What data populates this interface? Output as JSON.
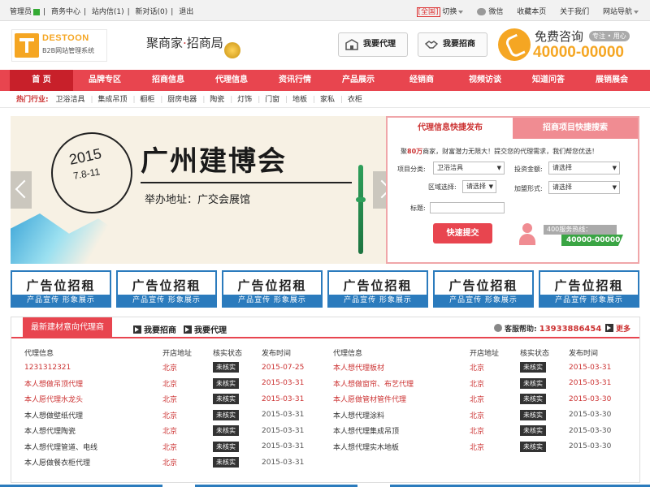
{
  "topbar": {
    "left": [
      "管理员",
      "商务中心",
      "站内信(1)",
      "新对话(0)",
      "退出"
    ],
    "region": "[全国]",
    "switch": "切换",
    "wechat": "微信",
    "fav": "收藏本页",
    "about": "关于我们",
    "sitenav": "网站导航"
  },
  "header": {
    "logo_name": "DESTOON",
    "logo_sub": "B2B网站管理系统",
    "slogan_a": "聚商家",
    "slogan_dot": "·",
    "slogan_b": "招商局",
    "btn_agent": "我要代理",
    "btn_merchant": "我要招商",
    "consult": "免费咨询",
    "consult_tag": "专注 • 用心",
    "hotline": "40000-00000"
  },
  "nav": [
    "首 页",
    "品牌专区",
    "招商信息",
    "代理信息",
    "资讯行情",
    "产品展示",
    "经销商",
    "视频访谈",
    "知道问答",
    "展销展会"
  ],
  "hot": {
    "label": "热门行业:",
    "items": [
      "卫浴洁具",
      "集成吊顶",
      "橱柜",
      "厨房电器",
      "陶瓷",
      "灯饰",
      "门窗",
      "地板",
      "家私",
      "衣柜"
    ]
  },
  "banner": {
    "year": "2015",
    "dates": "7.8-11",
    "title": "广州建博会",
    "address": "举办地址：广交会展馆"
  },
  "panel": {
    "tab1": "代理信息快捷发布",
    "tab2": "招商项目快捷搜索",
    "intro_pre": "聚",
    "intro_hl": "80万",
    "intro_post": "商家，财富潜力无限大！提交您的代理需求，我们帮您优选！",
    "category_label": "项目分类:",
    "category_value": "卫浴洁具",
    "invest_label": "投资金额:",
    "invest_value": "请选择",
    "region_label": "区域选择:",
    "region_value": "请选择",
    "join_label": "加盟形式:",
    "join_value": "请选择",
    "title_label": "标题:",
    "submit": "快速提交",
    "service_label": "400服务热线：",
    "service_num": "40000-00000"
  },
  "ads": [
    {
      "title": "广告位招租",
      "sub": "产品宣传 形象展示"
    },
    {
      "title": "广告位招租",
      "sub": "产品宣传 形象展示"
    },
    {
      "title": "广告位招租",
      "sub": "产品宣传 形象展示"
    },
    {
      "title": "广告位招租",
      "sub": "产品宣传 形象展示"
    },
    {
      "title": "广告位招租",
      "sub": "产品宣传 形象展示"
    },
    {
      "title": "广告位招租",
      "sub": "产品宣传 形象展示"
    }
  ],
  "listing": {
    "title": "最新建材意向代理商",
    "link1": "我要招商",
    "link2": "我要代理",
    "help_label": "客服帮助:",
    "help_num": "13933886454",
    "more": "更多",
    "columns": [
      "代理信息",
      "开店地址",
      "核实状态",
      "发布时间"
    ],
    "left_rows": [
      {
        "name": "1231312321",
        "city": "北京",
        "status": "未核实",
        "date": "2015-07-25"
      },
      {
        "name": "本人想做吊顶代理",
        "city": "北京",
        "status": "未核实",
        "date": "2015-03-31"
      },
      {
        "name": "本人愿代理水龙头",
        "city": "北京",
        "status": "未核实",
        "date": "2015-03-31"
      },
      {
        "name": "本人想做壁纸代理",
        "city": "北京",
        "status": "未核实",
        "date": "2015-03-31"
      },
      {
        "name": "本人想代理陶瓷",
        "city": "北京",
        "status": "未核实",
        "date": "2015-03-31"
      },
      {
        "name": "本人想代理管道、电线",
        "city": "北京",
        "status": "未核实",
        "date": "2015-03-31"
      },
      {
        "name": "本人愿做餐衣柜代理",
        "city": "北京",
        "status": "未核实",
        "date": "2015-03-31"
      }
    ],
    "right_rows": [
      {
        "name": "本人想代理板材",
        "city": "北京",
        "status": "未核实",
        "date": "2015-03-31"
      },
      {
        "name": "本人想做窗帘、布艺代理",
        "city": "北京",
        "status": "未核实",
        "date": "2015-03-31"
      },
      {
        "name": "本人愿做管材管件代理",
        "city": "北京",
        "status": "未核实",
        "date": "2015-03-30"
      },
      {
        "name": "本人想代理涂料",
        "city": "北京",
        "status": "未核实",
        "date": "2015-03-30"
      },
      {
        "name": "本人想代理集成吊顶",
        "city": "北京",
        "status": "未核实",
        "date": "2015-03-30"
      },
      {
        "name": "本人想代理实木地板",
        "city": "北京",
        "status": "未核实",
        "date": "2015-03-30"
      }
    ]
  }
}
